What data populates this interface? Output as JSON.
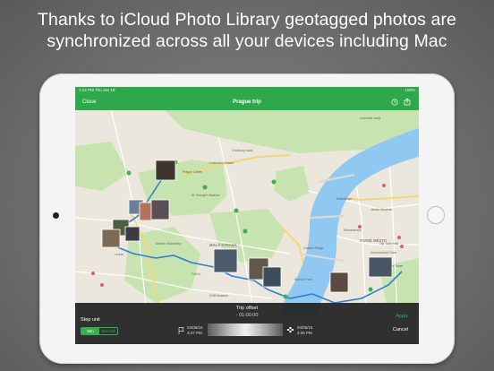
{
  "headline": {
    "line1": "Thanks to iCloud Photo Library geotagged photos are",
    "line2": "synchronized across all your devices including Mac"
  },
  "status_bar": {
    "time_date": "1:14 PM   Thu Jan 18",
    "battery": "100%",
    "center": ""
  },
  "nav": {
    "close_label": "Close",
    "title": "Prague trip"
  },
  "map_labels": {
    "park1": "Letenské sady",
    "church": "St. George's Basilica",
    "garden": "Strahov Monastery",
    "stromovka": "Chotkovy sady",
    "malostranska": "MALÁ STRANA",
    "stare_mesto": "STARÉ MĚSTO",
    "old_town": "Old Town Hall",
    "petrin": "Petřín",
    "lobkowicz": "Lobkowicz Palace",
    "charles": "Charles Bridge",
    "kampa": "Kampa Park",
    "jewish": "Jewish Museum",
    "rudolfinum": "Rudolfinum",
    "powder": "Powder Tower",
    "klementinum": "Klementinum",
    "astro": "Astronomical Clock",
    "loreta": "Loreta",
    "prague_castle": "Prague Castle",
    "nostic": "KGB Museum"
  },
  "controls": {
    "trip_offset_label": "Trip offset",
    "trip_offset_value": "- 01:00:00",
    "step_unit_label": "Step unit",
    "segment_min": "Min",
    "segment_second": "Second",
    "apply_label": "Apply",
    "cancel_label": "Cancel",
    "start_date": "04/06/15",
    "start_time": "3:47 PM",
    "end_date": "04/06/15",
    "end_time": "4:06 PM"
  },
  "colors": {
    "accent_green": "#2da84a",
    "river_blue": "#8fc8f0",
    "route_blue": "#2f7fd6",
    "park_green": "#c7e3b0"
  }
}
